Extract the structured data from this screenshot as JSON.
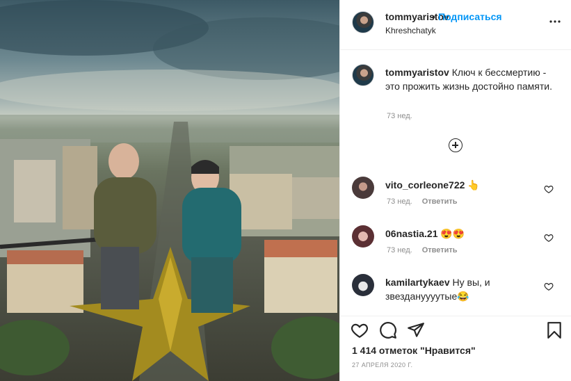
{
  "post": {
    "author": "tommyaristov",
    "separator": "•",
    "follow_label": "Подписаться",
    "location": "Khreshchatyk",
    "more_icon": "more-options-icon"
  },
  "caption": {
    "author": "tommyaristov",
    "text": "Ключ к бессмертию - это прожить жизнь достойно памяти.",
    "time": "73 нед."
  },
  "comments": [
    {
      "user": "vito_corleone722",
      "text": "👆",
      "time": "73 нед.",
      "reply": "Ответить"
    },
    {
      "user": "06nastia.21",
      "text": "😍😍",
      "time": "73 нед.",
      "reply": "Ответить"
    },
    {
      "user": "kamilartykaev",
      "text": "Ну вы, и звездануууутые😂",
      "time": "",
      "reply": ""
    }
  ],
  "stats": {
    "likes": "1 414 отметок \"Нравится\"",
    "date": "27 АПРЕЛЯ 2020 Г."
  },
  "icons": {
    "like": "heart-icon",
    "comment": "comment-icon",
    "share": "share-icon",
    "save": "bookmark-icon",
    "load_more": "plus-circle-icon"
  },
  "colors": {
    "accent": "#0095f6",
    "secondary_text": "#8e8e8e",
    "primary_text": "#262626",
    "border": "#efefef"
  }
}
